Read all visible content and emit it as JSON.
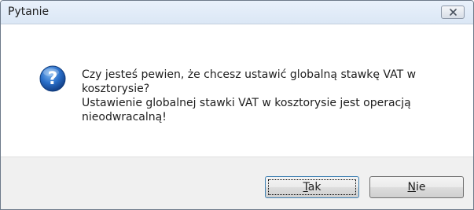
{
  "window": {
    "title": "Pytanie",
    "close_icon": "close-x-icon"
  },
  "message": {
    "icon": "question-icon",
    "line1": "Czy jesteś pewien, że chcesz ustawić globalną stawkę VAT w kosztorysie?",
    "line2": "Ustawienie globalnej stawki VAT w kosztorysie jest operacją nieodwracalną!"
  },
  "buttons": {
    "yes": {
      "accel": "T",
      "rest": "ak"
    },
    "no": {
      "accel": "N",
      "rest": "ie"
    }
  },
  "colors": {
    "title_bar": "#dbe7f5",
    "footer": "#f0f0f0",
    "icon_blue": "#1d5fb8"
  }
}
